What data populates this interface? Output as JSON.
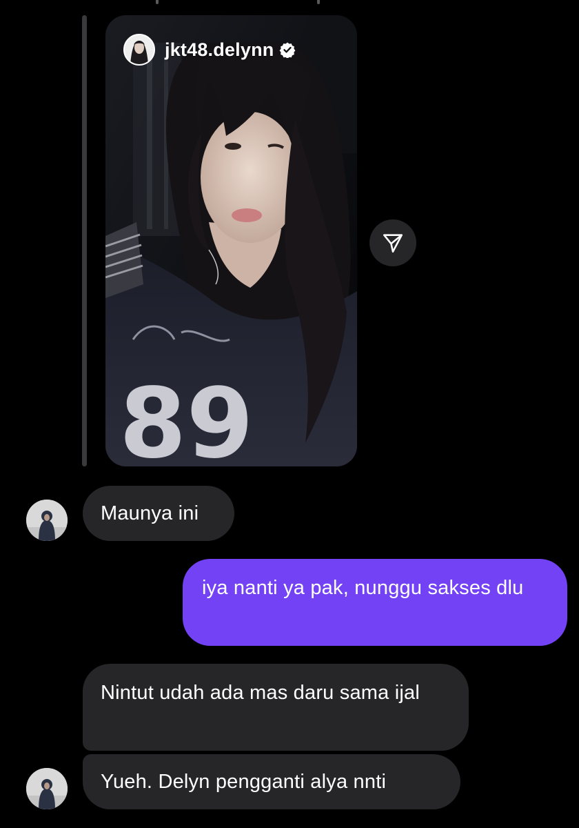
{
  "story": {
    "username": "jkt48.delynn",
    "verified": true,
    "shirt_text": "89"
  },
  "share_button": {
    "icon": "send-icon"
  },
  "messages": [
    {
      "from": "other",
      "text": "Maunya ini",
      "show_avatar": true
    },
    {
      "from": "me",
      "text": "iya nanti ya pak, nunggu sakses dlu"
    },
    {
      "from": "other",
      "text": "Nintut udah ada mas daru sama ijal",
      "show_avatar": false
    },
    {
      "from": "other",
      "text": "Yueh. Delyn pengganti alya nnti",
      "show_avatar": true
    }
  ],
  "colors": {
    "background": "#000000",
    "incoming_bubble": "#262628",
    "outgoing_bubble": "#7342f5",
    "text": "#ffffff"
  }
}
